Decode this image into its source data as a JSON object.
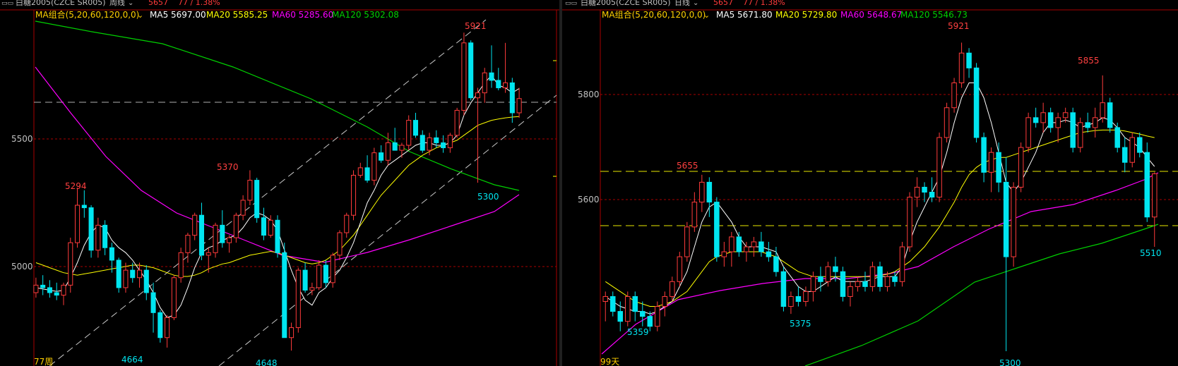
{
  "colors": {
    "up": "#ff3b3b",
    "down": "#00e5f0",
    "ma5": "#ffffff",
    "ma20": "#ffff00",
    "ma60": "#ff00ff",
    "ma120": "#00d000",
    "grid_red": "#a80000",
    "price_label": "#c0c0c0",
    "high_label": "#ff4040",
    "low_label": "#00e5f0",
    "pct": "#ff3b3b"
  },
  "left": {
    "title": "白糖2005(CZCE SR005)",
    "period": "周线",
    "price": "5657",
    "change": "77 / 1.38%",
    "ma_label": "MA组合(5,20,60,120,0,0)",
    "ma": {
      "ma5": "MA5 5697.00",
      "ma20": "MA20 5585.25",
      "ma60": "MA60 5285.60",
      "ma120": "MA120 5302.08"
    },
    "y_ticks": [
      "5500",
      "5000"
    ],
    "count_label": "77周",
    "annotations": {
      "hi1": "5294",
      "hi2": "5370",
      "hi3": "5921",
      "lo1": "4664",
      "lo2": "4648",
      "lo3": "5300"
    }
  },
  "right": {
    "title": "白糖2005(CZCE SR005)",
    "period": "日线",
    "price": "5657",
    "change": "77 / 1.38%",
    "ma_label": "MA组合(5,20,60,120,0,0)",
    "ma": {
      "ma5": "MA5 5671.80",
      "ma20": "MA20 5729.80",
      "ma60": "MA60 5648.67",
      "ma120": "MA120 5546.73"
    },
    "y_ticks": [
      "5800",
      "5600"
    ],
    "count_label": "99天",
    "annotations": {
      "hi1": "5655",
      "hi2": "5921",
      "hi3": "5855",
      "lo1": "5359",
      "lo2": "5375",
      "lo3": "5300",
      "lo4": "5510"
    }
  },
  "chart_data": [
    {
      "type": "candlestick",
      "period": "weekly",
      "ylim": [
        4640,
        5950
      ],
      "candles": [
        [
          4880,
          4940,
          4860,
          4910
        ],
        [
          4910,
          4950,
          4870,
          4900
        ],
        [
          4900,
          4930,
          4860,
          4880
        ],
        [
          4880,
          4920,
          4850,
          4870
        ],
        [
          4870,
          4920,
          4830,
          4910
        ],
        [
          4910,
          5100,
          4880,
          5080
        ],
        [
          5080,
          5300,
          5060,
          5230
        ],
        [
          5230,
          5290,
          5180,
          5220
        ],
        [
          5220,
          5230,
          5020,
          5050
        ],
        [
          5050,
          5180,
          5020,
          5150
        ],
        [
          5150,
          5170,
          5030,
          5060
        ],
        [
          5060,
          5080,
          4960,
          5010
        ],
        [
          5010,
          5020,
          4880,
          4900
        ],
        [
          4900,
          5000,
          4880,
          4970
        ],
        [
          4970,
          5000,
          4920,
          4940
        ],
        [
          4940,
          5000,
          4900,
          4970
        ],
        [
          4970,
          4990,
          4850,
          4880
        ],
        [
          4880,
          4920,
          4720,
          4800
        ],
        [
          4800,
          4810,
          4680,
          4700
        ],
        [
          4700,
          4790,
          4660,
          4780
        ],
        [
          4780,
          4950,
          4770,
          4940
        ],
        [
          4940,
          5060,
          4920,
          5040
        ],
        [
          5040,
          5120,
          5000,
          5110
        ],
        [
          5110,
          5200,
          5090,
          5190
        ],
        [
          5190,
          5240,
          5010,
          5030
        ],
        [
          5030,
          5060,
          4960,
          5040
        ],
        [
          5040,
          5160,
          5020,
          5150
        ],
        [
          5150,
          5210,
          5060,
          5080
        ],
        [
          5080,
          5110,
          5040,
          5100
        ],
        [
          5100,
          5200,
          5080,
          5190
        ],
        [
          5190,
          5270,
          5170,
          5250
        ],
        [
          5250,
          5370,
          5230,
          5330
        ],
        [
          5330,
          5340,
          5160,
          5180
        ],
        [
          5180,
          5220,
          5090,
          5110
        ],
        [
          5110,
          5190,
          5100,
          5170
        ],
        [
          5170,
          5190,
          5020,
          5040
        ],
        [
          5040,
          5080,
          4700,
          4700
        ],
        [
          4700,
          4760,
          4648,
          4740
        ],
        [
          4740,
          4980,
          4720,
          4970
        ],
        [
          4970,
          5000,
          4880,
          4890
        ],
        [
          4890,
          4920,
          4870,
          4900
        ],
        [
          4900,
          5010,
          4890,
          4990
        ],
        [
          4990,
          5010,
          4900,
          4920
        ],
        [
          4920,
          5040,
          4900,
          5030
        ],
        [
          5030,
          5130,
          5010,
          5120
        ],
        [
          5120,
          5200,
          5100,
          5190
        ],
        [
          5190,
          5370,
          5170,
          5350
        ],
        [
          5350,
          5400,
          5340,
          5380
        ],
        [
          5380,
          5430,
          5320,
          5330
        ],
        [
          5330,
          5460,
          5310,
          5440
        ],
        [
          5440,
          5470,
          5400,
          5410
        ],
        [
          5410,
          5520,
          5390,
          5480
        ],
        [
          5480,
          5540,
          5450,
          5450
        ],
        [
          5450,
          5480,
          5420,
          5470
        ],
        [
          5470,
          5590,
          5450,
          5570
        ],
        [
          5570,
          5600,
          5500,
          5510
        ],
        [
          5510,
          5530,
          5440,
          5450
        ],
        [
          5450,
          5520,
          5430,
          5500
        ],
        [
          5500,
          5530,
          5460,
          5480
        ],
        [
          5480,
          5510,
          5440,
          5460
        ],
        [
          5460,
          5520,
          5440,
          5510
        ],
        [
          5510,
          5620,
          5500,
          5610
        ],
        [
          5610,
          5921,
          5590,
          5880
        ],
        [
          5880,
          5890,
          5650,
          5660
        ],
        [
          5660,
          5700,
          5320,
          5680
        ],
        [
          5680,
          5780,
          5640,
          5760
        ],
        [
          5760,
          5870,
          5700,
          5730
        ],
        [
          5730,
          5780,
          5690,
          5700
        ],
        [
          5700,
          5880,
          5680,
          5720
        ],
        [
          5720,
          5740,
          5560,
          5600
        ],
        [
          5600,
          5700,
          5580,
          5657
        ]
      ],
      "ma5": [
        4900,
        4895,
        4890,
        4885,
        4890,
        4940,
        5000,
        5070,
        5120,
        5150,
        5140,
        5090,
        5060,
        5040,
        5010,
        4970,
        4930,
        4880,
        4820,
        4780,
        4790,
        4830,
        4900,
        4980,
        5040,
        5060,
        5070,
        5090,
        5100,
        5110,
        5140,
        5180,
        5200,
        5190,
        5170,
        5130,
        5050,
        4970,
        4900,
        4850,
        4830,
        4880,
        4900,
        4940,
        4970,
        5020,
        5080,
        5160,
        5240,
        5290,
        5350,
        5390,
        5410,
        5430,
        5450,
        5470,
        5480,
        5480,
        5470,
        5470,
        5480,
        5510,
        5590,
        5640,
        5680,
        5720,
        5750,
        5710,
        5700,
        5680,
        5697
      ],
      "ma20": [
        5000,
        4990,
        4980,
        4970,
        4960,
        4955,
        4950,
        4955,
        4960,
        4965,
        4970,
        4975,
        4980,
        4985,
        4990,
        4990,
        4985,
        4980,
        4970,
        4960,
        4950,
        4945,
        4945,
        4950,
        4960,
        4975,
        4985,
        4995,
        5000,
        5010,
        5020,
        5030,
        5035,
        5040,
        5045,
        5040,
        5030,
        5020,
        5010,
        5000,
        4995,
        5000,
        5010,
        5030,
        5050,
        5080,
        5110,
        5150,
        5190,
        5230,
        5270,
        5300,
        5330,
        5360,
        5390,
        5410,
        5430,
        5445,
        5460,
        5470,
        5480,
        5490,
        5510,
        5530,
        5550,
        5560,
        5570,
        5575,
        5580,
        5583,
        5585.25
      ]
    },
    {
      "type": "candlestick",
      "period": "daily",
      "ylim": [
        5290,
        5950
      ],
      "candles": [
        [
          5400,
          5420,
          5360,
          5410
        ],
        [
          5410,
          5420,
          5370,
          5380
        ],
        [
          5380,
          5400,
          5340,
          5360
        ],
        [
          5360,
          5420,
          5350,
          5410
        ],
        [
          5410,
          5420,
          5360,
          5380
        ],
        [
          5380,
          5400,
          5350,
          5370
        ],
        [
          5370,
          5380,
          5340,
          5350
        ],
        [
          5350,
          5400,
          5340,
          5390
        ],
        [
          5390,
          5420,
          5370,
          5410
        ],
        [
          5410,
          5450,
          5400,
          5440
        ],
        [
          5440,
          5500,
          5430,
          5490
        ],
        [
          5490,
          5560,
          5480,
          5550
        ],
        [
          5550,
          5620,
          5540,
          5600
        ],
        [
          5600,
          5655,
          5580,
          5640
        ],
        [
          5640,
          5650,
          5570,
          5600
        ],
        [
          5600,
          5610,
          5480,
          5490
        ],
        [
          5490,
          5520,
          5470,
          5500
        ],
        [
          5500,
          5540,
          5470,
          5530
        ],
        [
          5530,
          5540,
          5490,
          5500
        ],
        [
          5500,
          5520,
          5480,
          5510
        ],
        [
          5510,
          5530,
          5490,
          5520
        ],
        [
          5520,
          5540,
          5490,
          5500
        ],
        [
          5500,
          5520,
          5480,
          5490
        ],
        [
          5490,
          5510,
          5450,
          5460
        ],
        [
          5460,
          5470,
          5380,
          5390
        ],
        [
          5390,
          5420,
          5375,
          5410
        ],
        [
          5410,
          5430,
          5390,
          5400
        ],
        [
          5400,
          5430,
          5390,
          5420
        ],
        [
          5420,
          5460,
          5400,
          5450
        ],
        [
          5450,
          5470,
          5420,
          5440
        ],
        [
          5440,
          5480,
          5430,
          5470
        ],
        [
          5470,
          5490,
          5440,
          5460
        ],
        [
          5460,
          5470,
          5400,
          5410
        ],
        [
          5410,
          5440,
          5390,
          5430
        ],
        [
          5430,
          5450,
          5420,
          5440
        ],
        [
          5440,
          5460,
          5420,
          5430
        ],
        [
          5430,
          5480,
          5420,
          5470
        ],
        [
          5470,
          5480,
          5420,
          5430
        ],
        [
          5430,
          5460,
          5420,
          5450
        ],
        [
          5450,
          5460,
          5430,
          5440
        ],
        [
          5440,
          5520,
          5430,
          5510
        ],
        [
          5510,
          5620,
          5500,
          5610
        ],
        [
          5610,
          5650,
          5590,
          5630
        ],
        [
          5630,
          5640,
          5600,
          5620
        ],
        [
          5620,
          5650,
          5600,
          5610
        ],
        [
          5610,
          5740,
          5600,
          5730
        ],
        [
          5730,
          5800,
          5720,
          5790
        ],
        [
          5790,
          5850,
          5780,
          5840
        ],
        [
          5840,
          5921,
          5830,
          5900
        ],
        [
          5900,
          5910,
          5850,
          5870
        ],
        [
          5870,
          5880,
          5720,
          5730
        ],
        [
          5730,
          5740,
          5640,
          5660
        ],
        [
          5660,
          5710,
          5620,
          5700
        ],
        [
          5700,
          5720,
          5620,
          5640
        ],
        [
          5640,
          5690,
          5300,
          5490
        ],
        [
          5490,
          5640,
          5470,
          5630
        ],
        [
          5630,
          5720,
          5620,
          5710
        ],
        [
          5710,
          5780,
          5700,
          5770
        ],
        [
          5770,
          5790,
          5750,
          5760
        ],
        [
          5760,
          5800,
          5740,
          5780
        ],
        [
          5780,
          5790,
          5740,
          5750
        ],
        [
          5750,
          5780,
          5720,
          5770
        ],
        [
          5770,
          5790,
          5760,
          5780
        ],
        [
          5780,
          5790,
          5700,
          5710
        ],
        [
          5710,
          5770,
          5700,
          5760
        ],
        [
          5760,
          5780,
          5740,
          5750
        ],
        [
          5750,
          5790,
          5730,
          5770
        ],
        [
          5770,
          5855,
          5760,
          5800
        ],
        [
          5800,
          5810,
          5740,
          5750
        ],
        [
          5750,
          5760,
          5700,
          5710
        ],
        [
          5710,
          5730,
          5660,
          5680
        ],
        [
          5680,
          5740,
          5670,
          5730
        ],
        [
          5730,
          5740,
          5690,
          5700
        ],
        [
          5700,
          5720,
          5560,
          5570
        ],
        [
          5570,
          5660,
          5510,
          5657
        ]
      ],
      "ma5": [
        5410,
        5400,
        5390,
        5385,
        5380,
        5380,
        5375,
        5380,
        5390,
        5400,
        5430,
        5460,
        5510,
        5560,
        5590,
        5600,
        5580,
        5560,
        5530,
        5510,
        5510,
        5510,
        5505,
        5500,
        5470,
        5450,
        5430,
        5420,
        5420,
        5430,
        5440,
        5450,
        5440,
        5440,
        5440,
        5440,
        5445,
        5450,
        5450,
        5450,
        5470,
        5520,
        5560,
        5590,
        5620,
        5650,
        5700,
        5760,
        5810,
        5840,
        5840,
        5810,
        5760,
        5700,
        5640,
        5620,
        5640,
        5670,
        5700,
        5740,
        5760,
        5760,
        5765,
        5760,
        5750,
        5755,
        5760,
        5770,
        5765,
        5750,
        5730,
        5720,
        5710,
        5690,
        5671.8
      ],
      "ma20": [
        5440,
        5430,
        5420,
        5410,
        5400,
        5395,
        5390,
        5390,
        5395,
        5400,
        5410,
        5420,
        5440,
        5460,
        5480,
        5490,
        5495,
        5500,
        5500,
        5500,
        5500,
        5500,
        5495,
        5490,
        5480,
        5470,
        5460,
        5455,
        5450,
        5450,
        5450,
        5450,
        5450,
        5450,
        5450,
        5450,
        5450,
        5452,
        5455,
        5460,
        5470,
        5480,
        5495,
        5510,
        5530,
        5550,
        5575,
        5600,
        5630,
        5655,
        5670,
        5680,
        5685,
        5690,
        5690,
        5695,
        5700,
        5705,
        5710,
        5715,
        5720,
        5725,
        5730,
        5735,
        5740,
        5742,
        5744,
        5745,
        5745,
        5745,
        5743,
        5740,
        5737,
        5733,
        5729.8
      ]
    }
  ]
}
